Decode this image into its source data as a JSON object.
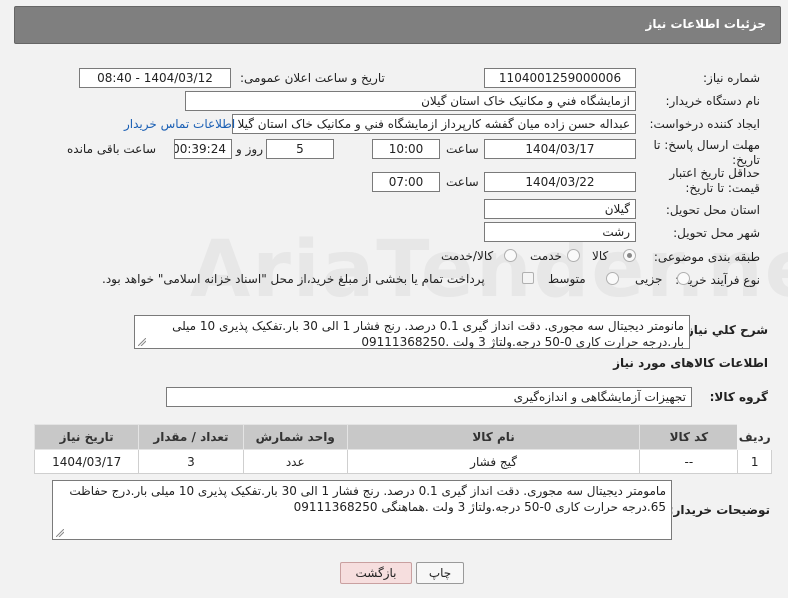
{
  "header": {
    "title": "جزئیات اطلاعات نیاز"
  },
  "fields": {
    "need_number_label": "شماره نیاز:",
    "need_number": "1104001259000006",
    "announce_label": "تاریخ و ساعت اعلان عمومی:",
    "announce_value": "1404/03/12 - 08:40",
    "buyer_org_label": "نام دستگاه خریدار:",
    "buyer_org": "ازمایشگاه فني و مکانيک خاک استان گيلان",
    "creator_label": "ایجاد کننده درخواست:",
    "creator": "عبداله حسن زاده میان گفشه کارپرداز ازمایشگاه فني و مکانيک خاک استان گيلا",
    "contact_link": "اطلاعات تماس خریدار",
    "reply_deadline_label": "مهلت ارسال پاسخ: تا تاریخ:",
    "reply_date": "1404/03/17",
    "time_label": "ساعت",
    "reply_time": "10:00",
    "days_value": "5",
    "days_label": "روز و",
    "remaining_time": "00:39:24",
    "remaining_label": "ساعت باقی مانده",
    "price_validity_label": "حداقل تاریخ اعتبار قیمت: تا تاریخ:",
    "price_date": "1404/03/22",
    "price_time": "07:00",
    "province_label": "استان محل تحویل:",
    "province": "گيلان",
    "city_label": "شهر محل تحویل:",
    "city": "رشت",
    "category_label": "طبقه بندی موضوعی:",
    "category_options": [
      "کالا",
      "خدمت",
      "کالا/خدمت"
    ],
    "process_label": "نوع فرآیند خرید :",
    "process_options": [
      "جزیی",
      "متوسط"
    ],
    "payment_note": "پرداخت تمام یا بخشی از مبلغ خرید،از محل \"اسناد خزانه اسلامی\" خواهد بود."
  },
  "description": {
    "label": "شرح کلي نیاز:",
    "text": "مانومتر دیجیتال سه مجوری. دقت انداز گیری 0.1 درصد. رنج فشار 1 الی 30 بار.تفکیک پذیری 10 میلی بار.درجه حرارت کاری 0-50 درجه.ولتاژ 3 ولت .09111368250"
  },
  "goods": {
    "section_title": "اطلاعات کالاهای مورد نیاز",
    "group_label": "گروه کالا:",
    "group_value": "تجهیزات آزمایشگاهی و اندازه‌گیری",
    "columns": [
      "ردیف",
      "کد کالا",
      "نام کالا",
      "واحد شمارش",
      "تعداد / مقدار",
      "تاریخ نیاز"
    ],
    "rows": [
      [
        "1",
        "--",
        "گیج فشار",
        "عدد",
        "3",
        "1404/03/17"
      ]
    ]
  },
  "buyer_notes": {
    "label": "توضیحات خریدار:",
    "text": "مامومتر دیجیتال سه مجوری. دقت انداز گیری 0.1 درصد. رنج فشار 1 الی 30 بار.تفکیک پذیری 10 میلی بار.درج حفاظت 65.درجه حرارت کاری 0-50 درجه.ولتاژ 3 ولت .هماهنگی 09111368250"
  },
  "buttons": {
    "print": "چاپ",
    "back": "بازگشت"
  },
  "watermark": "AriaTender.neT"
}
